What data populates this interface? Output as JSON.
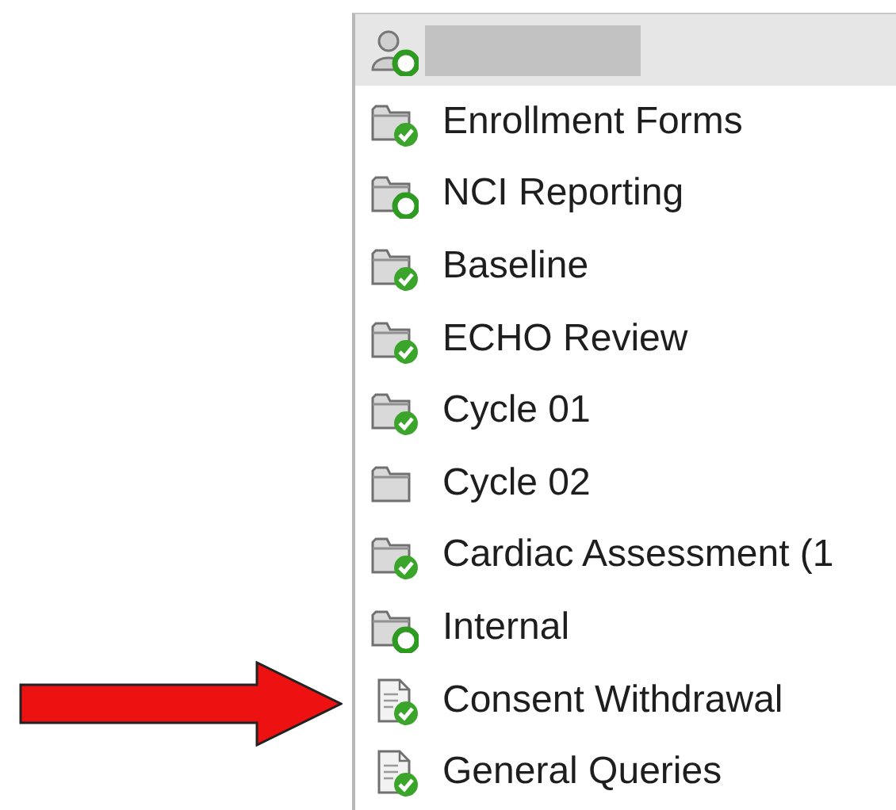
{
  "header": {
    "kind": "user"
  },
  "items": [
    {
      "label": "Enrollment Forms",
      "kind": "folder-check"
    },
    {
      "label": "NCI Reporting",
      "kind": "folder-circle"
    },
    {
      "label": "Baseline",
      "kind": "folder-check"
    },
    {
      "label": "ECHO Review",
      "kind": "folder-check"
    },
    {
      "label": "Cycle 01",
      "kind": "folder-check"
    },
    {
      "label": "Cycle 02",
      "kind": "folder"
    },
    {
      "label": "Cardiac Assessment (1",
      "kind": "folder-check"
    },
    {
      "label": "Internal",
      "kind": "folder-circle"
    },
    {
      "label": "Consent Withdrawal",
      "kind": "document-check"
    },
    {
      "label": "General Queries",
      "kind": "document-check"
    }
  ]
}
